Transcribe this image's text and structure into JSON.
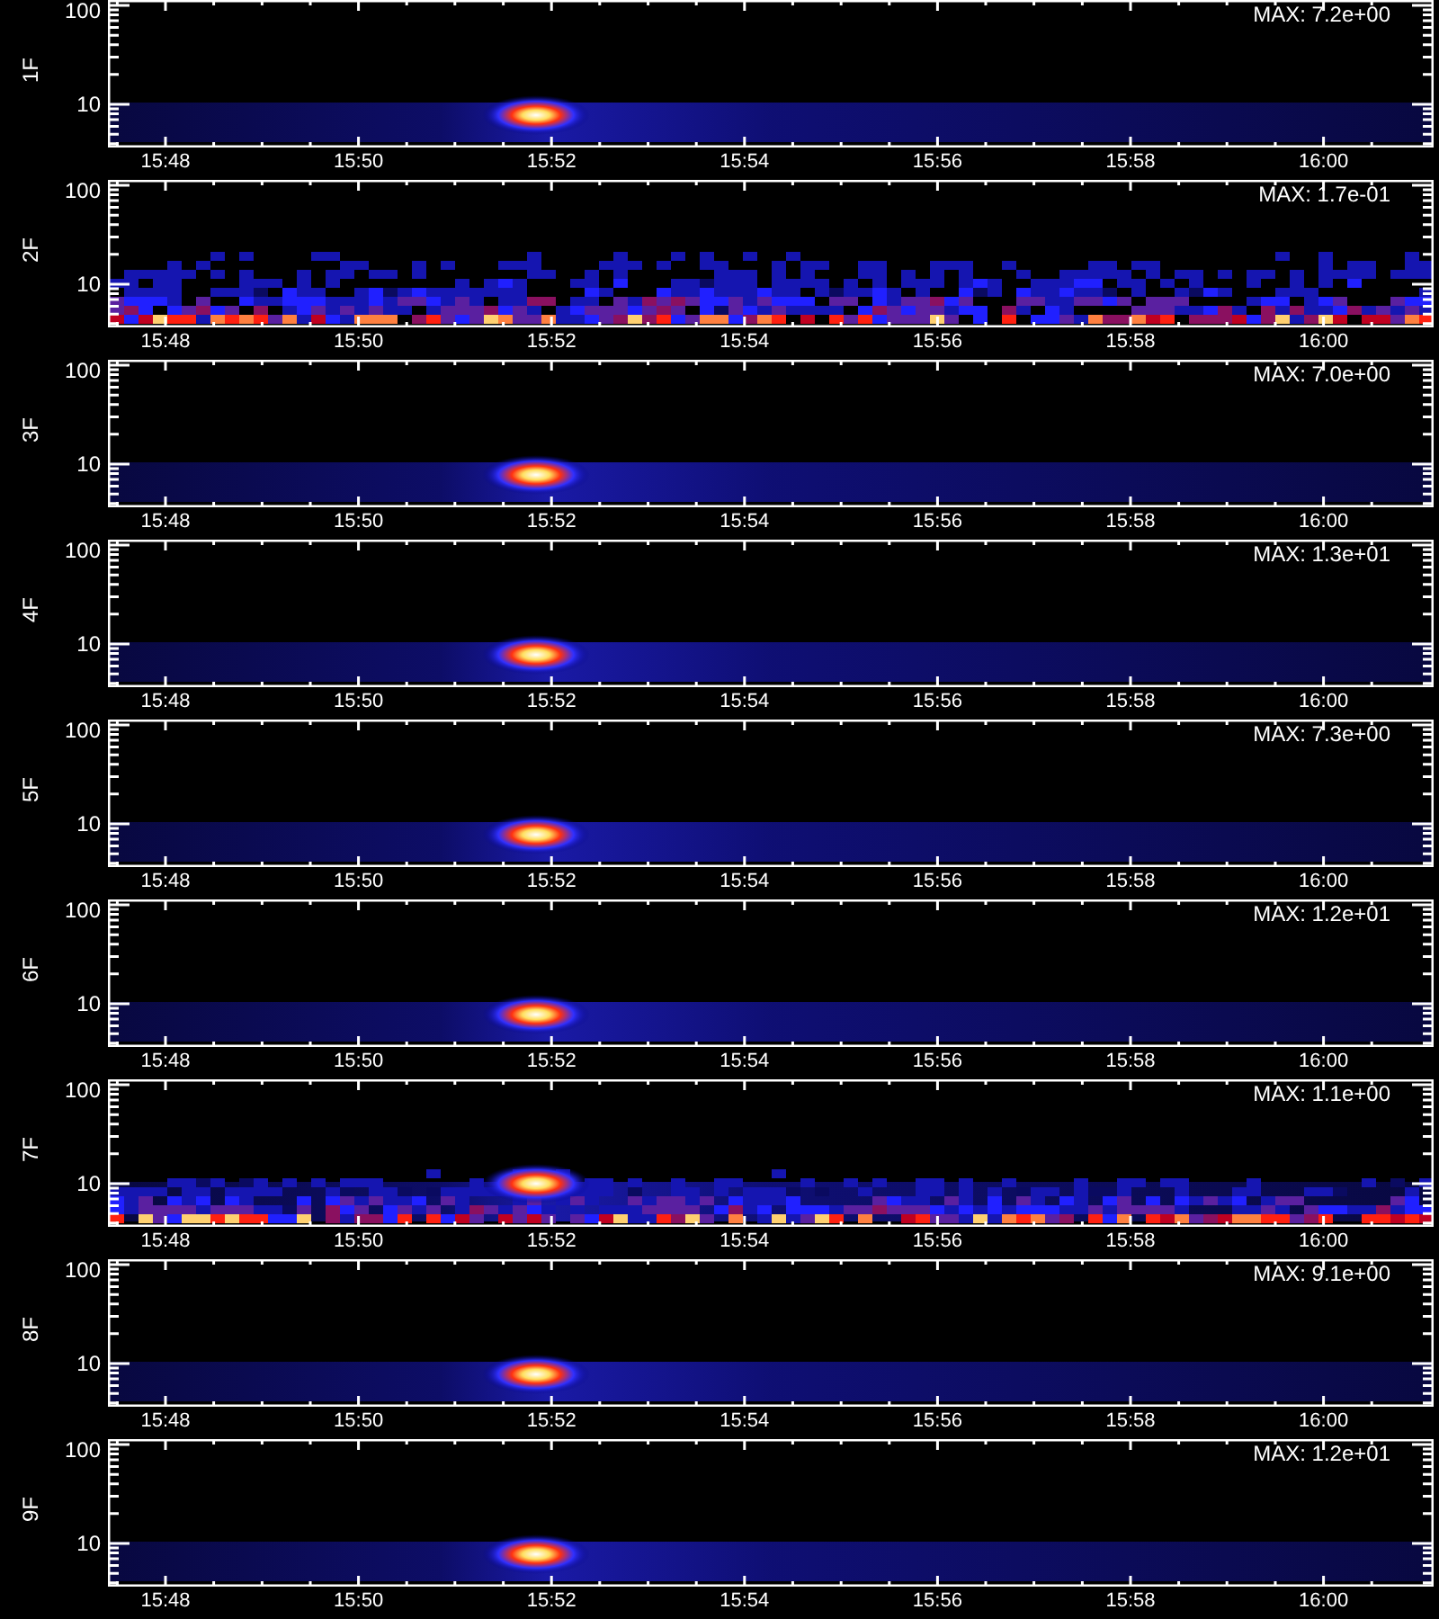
{
  "panels": [
    {
      "label": "1F",
      "kind": "flare",
      "max": "MAX: 7.2e+00",
      "y_ticks": [
        "100",
        "10"
      ],
      "x_ticks": [
        "15:48",
        "15:50",
        "15:52",
        "15:54",
        "15:56",
        "15:58",
        "16:00"
      ]
    },
    {
      "label": "2F",
      "kind": "noise",
      "max": "MAX: 1.7e-01",
      "y_ticks": [
        "100",
        "10"
      ],
      "x_ticks": [
        "15:48",
        "15:50",
        "15:52",
        "15:54",
        "15:56",
        "15:58",
        "16:00"
      ]
    },
    {
      "label": "3F",
      "kind": "flare",
      "max": "MAX: 7.0e+00",
      "y_ticks": [
        "100",
        "10"
      ],
      "x_ticks": [
        "15:48",
        "15:50",
        "15:52",
        "15:54",
        "15:56",
        "15:58",
        "16:00"
      ]
    },
    {
      "label": "4F",
      "kind": "flare",
      "max": "MAX: 1.3e+01",
      "y_ticks": [
        "100",
        "10"
      ],
      "x_ticks": [
        "15:48",
        "15:50",
        "15:52",
        "15:54",
        "15:56",
        "15:58",
        "16:00"
      ]
    },
    {
      "label": "5F",
      "kind": "flare",
      "max": "MAX: 7.3e+00",
      "y_ticks": [
        "100",
        "10"
      ],
      "x_ticks": [
        "15:48",
        "15:50",
        "15:52",
        "15:54",
        "15:56",
        "15:58",
        "16:00"
      ]
    },
    {
      "label": "6F",
      "kind": "flare",
      "max": "MAX: 1.2e+01",
      "y_ticks": [
        "100",
        "10"
      ],
      "x_ticks": [
        "15:48",
        "15:50",
        "15:52",
        "15:54",
        "15:56",
        "15:58",
        "16:00"
      ]
    },
    {
      "label": "7F",
      "kind": "flare_noise",
      "max": "MAX: 1.1e+00",
      "y_ticks": [
        "100",
        "10"
      ],
      "x_ticks": [
        "15:48",
        "15:50",
        "15:52",
        "15:54",
        "15:56",
        "15:58",
        "16:00"
      ]
    },
    {
      "label": "8F",
      "kind": "flare",
      "max": "MAX: 9.1e+00",
      "y_ticks": [
        "100",
        "10"
      ],
      "x_ticks": [
        "15:48",
        "15:50",
        "15:52",
        "15:54",
        "15:56",
        "15:58",
        "16:00"
      ]
    },
    {
      "label": "9F",
      "kind": "flare",
      "max": "MAX: 1.2e+01",
      "y_ticks": [
        "100",
        "10"
      ],
      "x_ticks": [
        "15:48",
        "15:50",
        "15:52",
        "15:54",
        "15:56",
        "15:58",
        "16:00"
      ]
    }
  ]
}
